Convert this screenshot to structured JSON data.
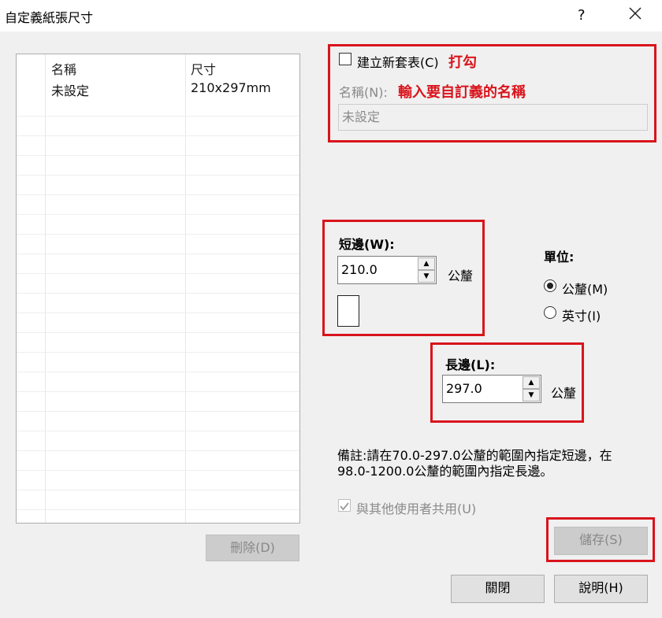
{
  "window": {
    "title": "自定義紙張尺寸",
    "help": "?",
    "close_icon": "close-icon"
  },
  "list": {
    "columns": [
      "名稱",
      "尺寸"
    ],
    "rows": [
      [
        "未設定",
        "210x297mm"
      ]
    ]
  },
  "buttons": {
    "delete": "刪除(D)",
    "save": "儲存(S)",
    "close": "關閉",
    "help": "說明(H)"
  },
  "create_new": {
    "label": "建立新套表(C)",
    "checked": false,
    "annotation": "打勾"
  },
  "name": {
    "label": "名稱(N):",
    "value": "未設定",
    "annotation": "輸入要自訂義的名稱"
  },
  "width": {
    "label": "短邊(W):",
    "value": "210.0",
    "unit": "公釐"
  },
  "length": {
    "label": "長邊(L):",
    "value": "297.0",
    "unit": "公釐"
  },
  "units": {
    "label": "單位:",
    "options": [
      "公釐(M)",
      "英寸(I)"
    ],
    "selected": "公釐(M)"
  },
  "note": {
    "line1": "備註:請在70.0-297.0公釐的範圍內指定短邊，在",
    "line2": "98.0-1200.0公釐的範圍內指定長邊。"
  },
  "share": {
    "label": "與其他使用者共用(U)",
    "checked": true
  },
  "colors": {
    "annotation": "#d9141c"
  }
}
